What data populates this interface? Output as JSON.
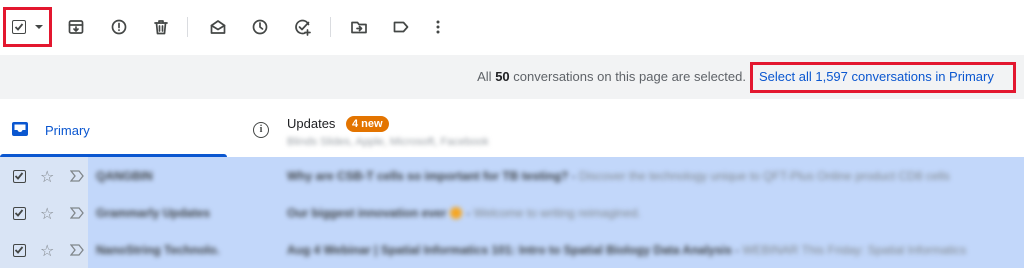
{
  "toolbar": {
    "buttons": [
      {
        "name": "archive-icon"
      },
      {
        "name": "report-spam-icon"
      },
      {
        "name": "delete-icon"
      },
      {
        "name": "mark-as-read-icon"
      },
      {
        "name": "snooze-icon"
      },
      {
        "name": "add-to-tasks-icon"
      },
      {
        "name": "move-to-icon"
      },
      {
        "name": "label-icon"
      },
      {
        "name": "more-options-icon"
      }
    ]
  },
  "banner": {
    "prefix": "All",
    "count": "50",
    "suffix": "conversations on this page are selected.",
    "link": "Select all 1,597 conversations in Primary"
  },
  "tabs": {
    "primary": {
      "label": "Primary",
      "icon": "inbox-icon"
    },
    "updates": {
      "label": "Updates",
      "badge": "4 new",
      "subtitle": "Blinds Slides, Apple, Microsoft, Facebook"
    }
  },
  "emails": [
    {
      "sender": "QANGBIN",
      "subject": "Why are CSB-T cells so important for TB testing?",
      "preview": "Discover the technology unique to QFT-Plus Online product CD8 cells",
      "has_emoji": false
    },
    {
      "sender": "Grammarly Updates",
      "subject": "Our biggest innovation ever",
      "preview": "Welcome to writing reimagined.",
      "has_emoji": true
    },
    {
      "sender": "NanoString Technolo.",
      "subject": "Aug 4 Webinar | Spatial Informatics 101: Intro to Spatial Biology Data Analysis",
      "preview": "WEBINAR This Friday: Spatial Informatics",
      "has_emoji": false
    }
  ],
  "colors": {
    "accent": "#0b57d0",
    "selected_row": "#c2d7fa",
    "badge": "#e37400",
    "highlight_box": "#e3172f"
  }
}
